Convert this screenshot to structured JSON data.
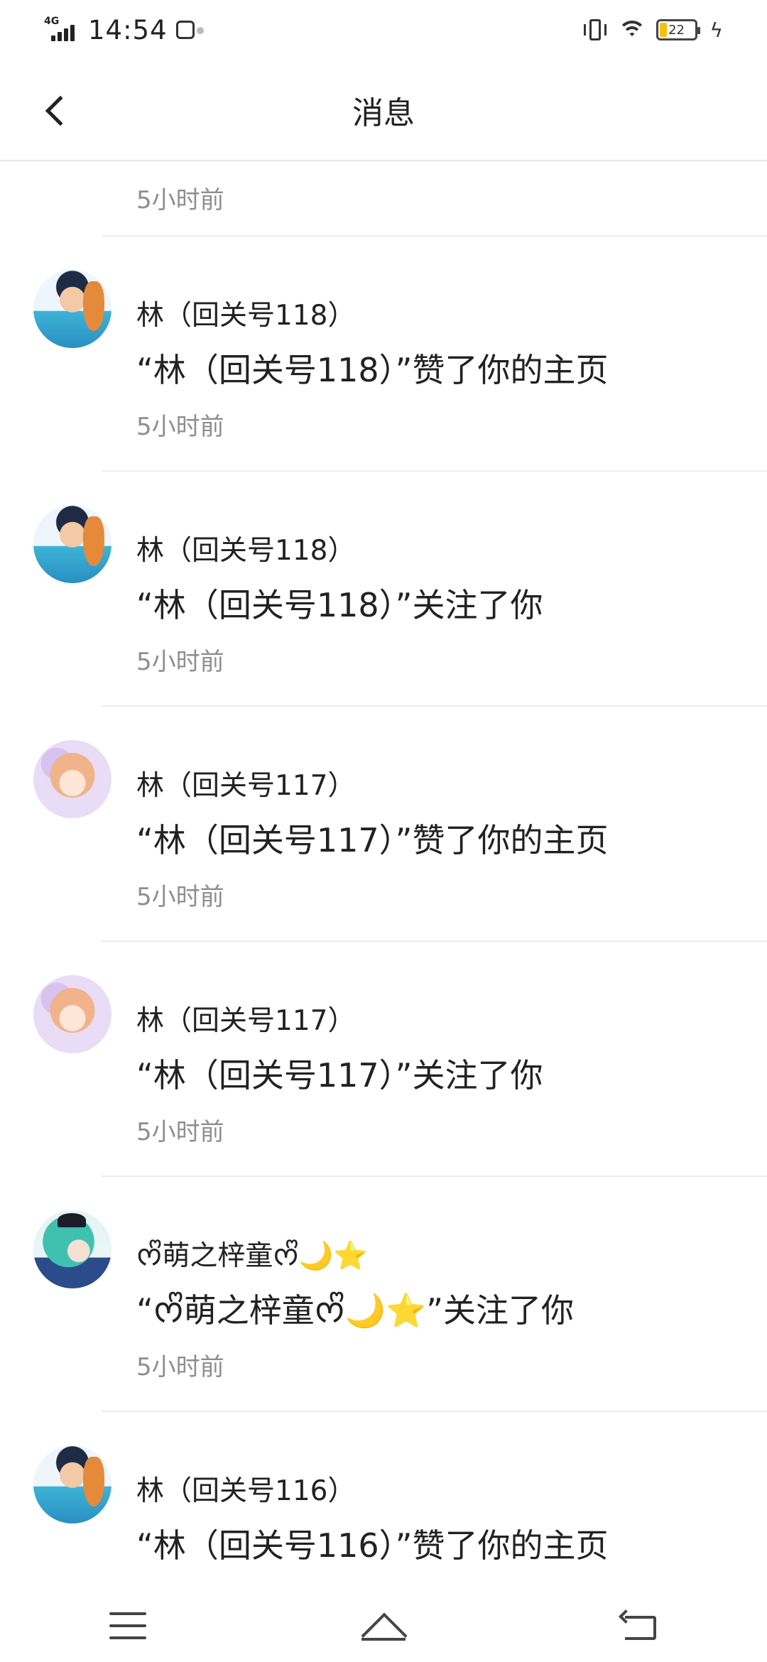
{
  "status_bar": {
    "network": "4G",
    "time": "14:54",
    "battery_level": "22",
    "charging_icon": "bolt-icon"
  },
  "header": {
    "title": "消息",
    "back_icon": "chevron-left-icon"
  },
  "partial_item": {
    "time": "5小时前"
  },
  "messages": [
    {
      "avatar": "boy-with-fox-avatar",
      "name": "林（回关号118）",
      "action": "“林（回关号118）”赞了你的主页",
      "time": "5小时前"
    },
    {
      "avatar": "boy-with-fox-avatar",
      "name": "林（回关号118）",
      "action": "“林（回关号118）”关注了你",
      "time": "5小时前"
    },
    {
      "avatar": "girl-pink-avatar",
      "name": "林（回关号117）",
      "action": "“林（回关号117）”赞了你的主页",
      "time": "5小时前"
    },
    {
      "avatar": "girl-pink-avatar",
      "name": "林（回关号117）",
      "action": "“林（回关号117）”关注了你",
      "time": "5小时前"
    },
    {
      "avatar": "anime-teal-hair-avatar",
      "name": "ᰔᩚ萌之梓童ᰔᩚ🌙⭐",
      "action": "“ᰔᩚ萌之梓童ᰔᩚ🌙⭐”关注了你",
      "time": "5小时前"
    },
    {
      "avatar": "boy-with-fox-avatar",
      "name": "林（回关号116）",
      "action": "“林（回关号116）”赞了你的主页",
      "time": ""
    }
  ],
  "bottom_nav": {
    "menu_icon": "menu-icon",
    "home_icon": "home-icon",
    "back_icon": "return-icon"
  }
}
